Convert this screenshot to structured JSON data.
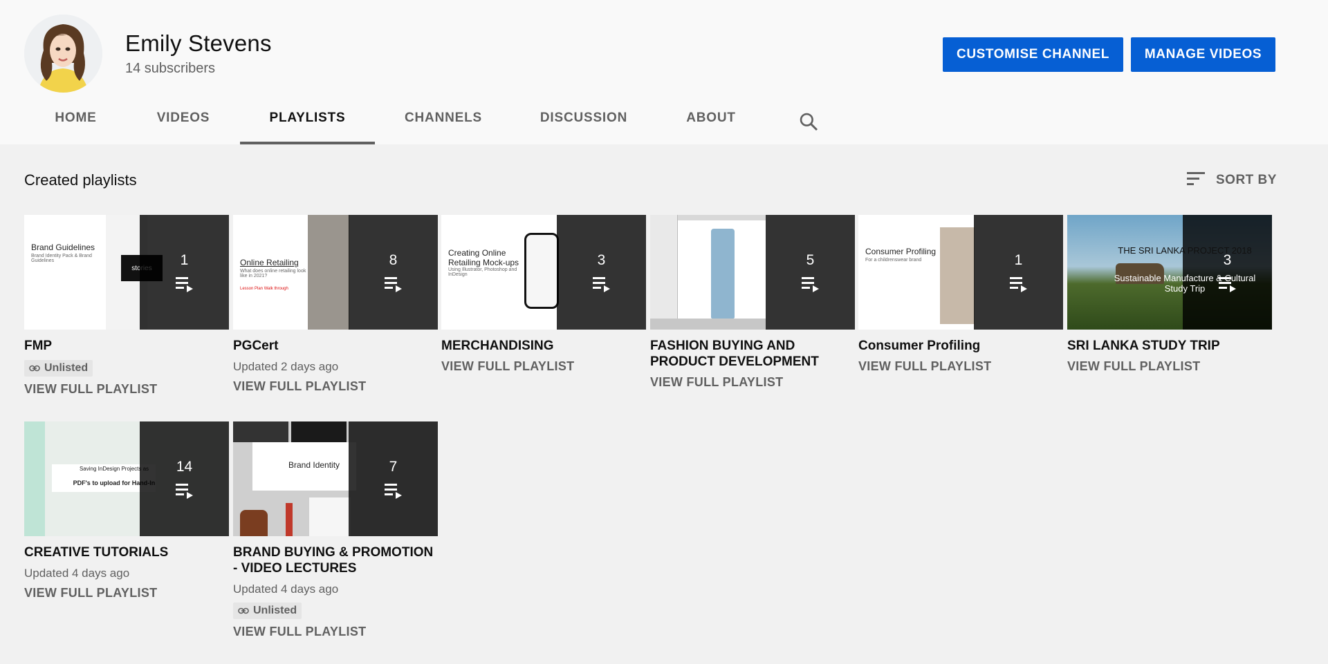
{
  "channel": {
    "name": "Emily Stevens",
    "subscribers": "14 subscribers",
    "customise_label": "CUSTOMISE CHANNEL",
    "manage_label": "MANAGE VIDEOS"
  },
  "tabs": [
    {
      "label": "HOME",
      "active": false
    },
    {
      "label": "VIDEOS",
      "active": false
    },
    {
      "label": "PLAYLISTS",
      "active": true
    },
    {
      "label": "CHANNELS",
      "active": false
    },
    {
      "label": "DISCUSSION",
      "active": false
    },
    {
      "label": "ABOUT",
      "active": false
    }
  ],
  "section": {
    "title": "Created playlists",
    "sort_label": "SORT BY"
  },
  "colors": {
    "accent": "#065fd4",
    "text_primary": "#0f0f0f",
    "text_secondary": "#606060",
    "header_bg": "#f9f9f9",
    "page_bg": "#f1f1f1"
  },
  "icons": {
    "search": "search-icon",
    "sort": "sort-icon",
    "playlist": "playlist-icon",
    "link": "link-icon"
  },
  "playlists": [
    {
      "title": "FMP",
      "count": "1",
      "badge": "Unlisted",
      "meta": "",
      "view_label": "VIEW FULL PLAYLIST",
      "thumb_text": {
        "heading": "Brand Guidelines",
        "sub": "Brand Identity Pack & Brand Guidelines",
        "extra": "stories"
      }
    },
    {
      "title": "PGCert",
      "count": "8",
      "badge": "",
      "meta": "Updated 2 days ago",
      "view_label": "VIEW FULL PLAYLIST",
      "thumb_text": {
        "heading": "Online Retailing",
        "sub": "What does online retailing look like in 2021?",
        "extra": "Lesson Plan Walk through"
      }
    },
    {
      "title": "MERCHANDISING",
      "count": "3",
      "badge": "",
      "meta": "",
      "view_label": "VIEW FULL PLAYLIST",
      "thumb_text": {
        "heading": "Creating Online Retailing Mock-ups",
        "sub": "Using Illustrator, Photoshop and InDesign",
        "extra": ""
      }
    },
    {
      "title": "FASHION BUYING AND PRODUCT DEVELOPMENT",
      "count": "5",
      "badge": "",
      "meta": "",
      "view_label": "VIEW FULL PLAYLIST",
      "thumb_text": {
        "heading": "",
        "sub": "",
        "extra": ""
      }
    },
    {
      "title": "Consumer Profiling",
      "count": "1",
      "badge": "",
      "meta": "",
      "view_label": "VIEW FULL PLAYLIST",
      "thumb_text": {
        "heading": "Consumer Profiling",
        "sub": "For a childrenswear brand",
        "extra": ""
      }
    },
    {
      "title": "SRI LANKA STUDY TRIP",
      "count": "3",
      "badge": "",
      "meta": "",
      "view_label": "VIEW FULL PLAYLIST",
      "thumb_text": {
        "heading": "THE SRI LANKA PROJECT 2018",
        "sub": "Sustainable Manufacture & Cultural Study Trip",
        "extra": ""
      }
    },
    {
      "title": "CREATIVE TUTORIALS",
      "count": "14",
      "badge": "",
      "meta": "Updated 4 days ago",
      "view_label": "VIEW FULL PLAYLIST",
      "thumb_text": {
        "heading": "Saving InDesign Projects as",
        "sub": "PDF's to upload for Hand-In",
        "extra": ""
      }
    },
    {
      "title": "BRAND BUYING & PROMOTION - VIDEO LECTURES",
      "count": "7",
      "badge": "Unlisted",
      "meta": "Updated 4 days ago",
      "view_label": "VIEW FULL PLAYLIST",
      "thumb_text": {
        "heading": "Brand Identity",
        "sub": "",
        "extra": ""
      }
    }
  ]
}
